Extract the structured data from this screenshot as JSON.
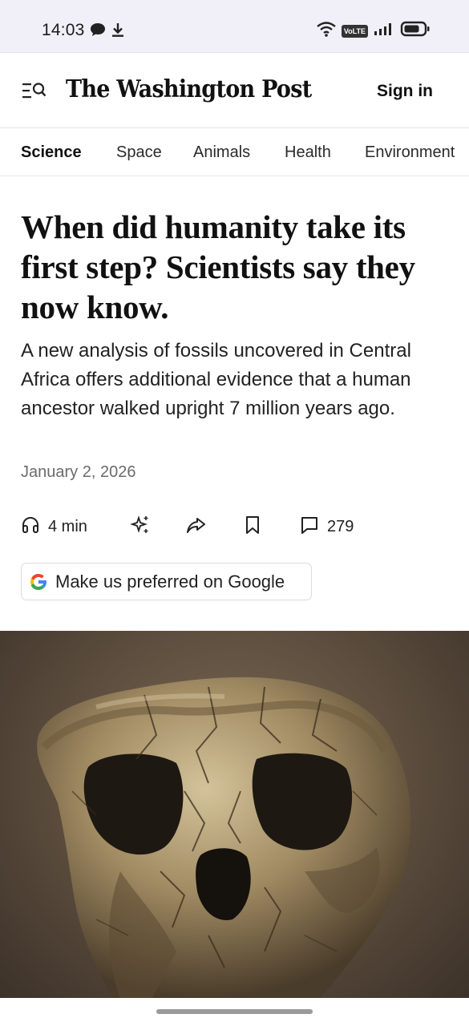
{
  "status_bar": {
    "time": "14:03",
    "left_icons": [
      "chat-bubble-icon",
      "download-icon"
    ],
    "right_icons": [
      "wifi-icon",
      "volte-icon",
      "signal-icon",
      "battery-icon"
    ],
    "volte_label": "VoLTE"
  },
  "header": {
    "menu_icon": "menu-search-icon",
    "logo": "The Washington Post",
    "sign_in": "Sign in"
  },
  "nav": {
    "items": [
      {
        "label": "Science",
        "active": true
      },
      {
        "label": "Space",
        "active": false
      },
      {
        "label": "Animals",
        "active": false
      },
      {
        "label": "Health",
        "active": false
      },
      {
        "label": "Environment",
        "active": false
      }
    ]
  },
  "article": {
    "headline": "When did humanity take its first step? Scientists say they now know.",
    "dek": "A new analysis of fossils uncovered in Central Africa offers additional evidence that a human ancestor walked upright 7 million years ago.",
    "date": "January 2, 2026"
  },
  "actions": {
    "listen_label": "4 min",
    "listen_icon": "headphones-icon",
    "summarize_icon": "sparkle-icon",
    "share_icon": "share-icon",
    "save_icon": "bookmark-icon",
    "comments_icon": "comment-icon",
    "comments_count": "279"
  },
  "google_pref": {
    "label": "Make us preferred on Google",
    "icon": "google-g-icon"
  },
  "hero_image": {
    "subject": "fossil-skull-image"
  },
  "colors": {
    "status_bg": "#f1eff7",
    "text": "#111111",
    "muted": "#6b6b6b",
    "google_blue": "#4285F4",
    "google_red": "#EA4335",
    "google_yellow": "#FBBC05",
    "google_green": "#34A853"
  }
}
